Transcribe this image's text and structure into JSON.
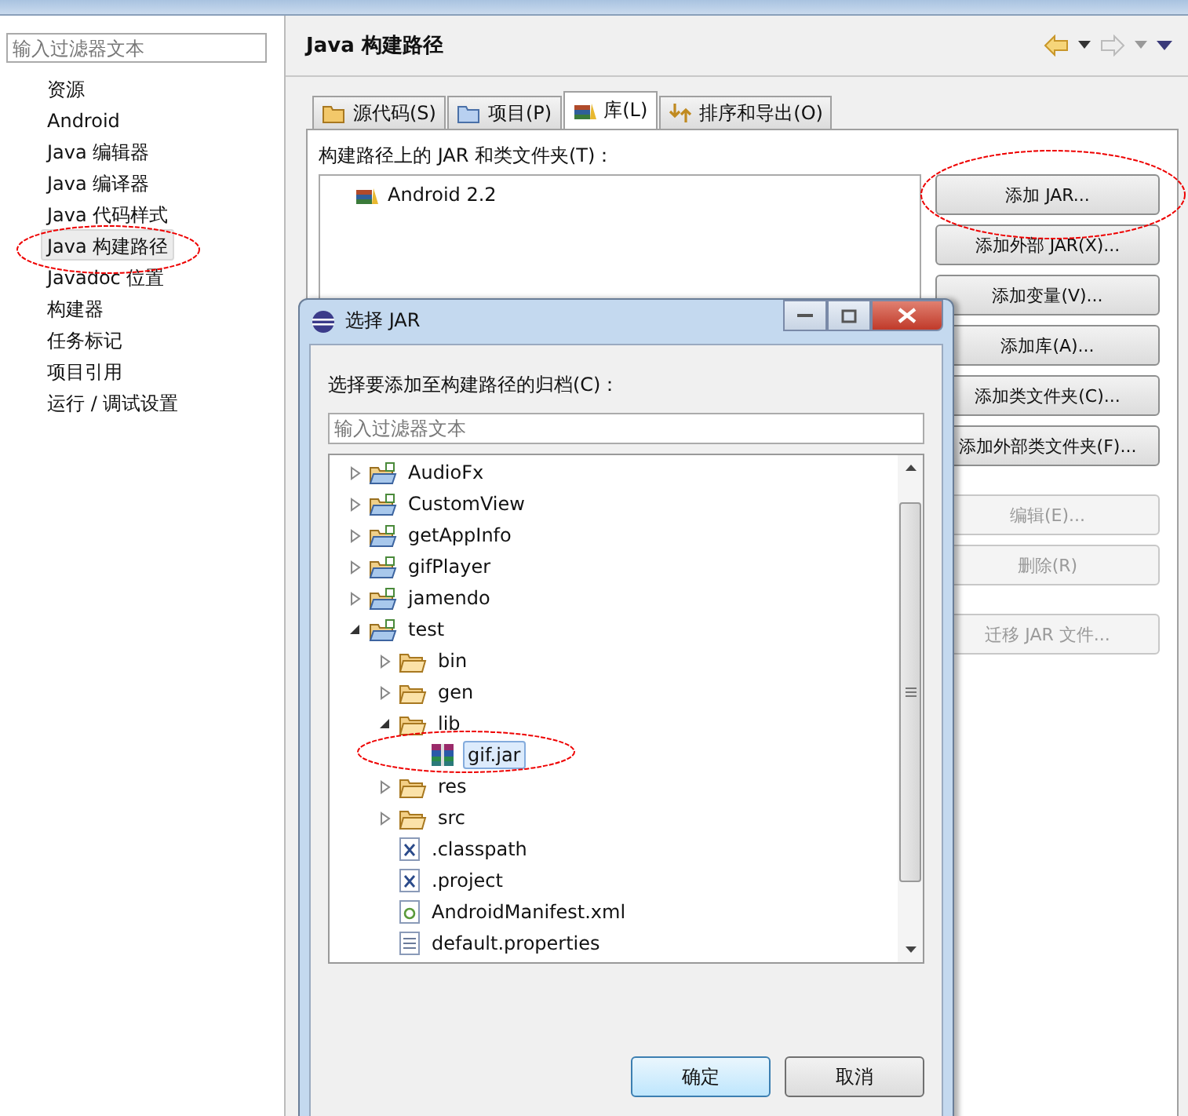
{
  "sidebar": {
    "filter": {
      "placeholder": "输入过滤器文本"
    },
    "items": [
      {
        "label": "资源",
        "selected": false
      },
      {
        "label": "Android",
        "selected": false
      },
      {
        "label": "Java 编辑器",
        "selected": false
      },
      {
        "label": "Java 编译器",
        "selected": false
      },
      {
        "label": "Java 代码样式",
        "selected": false
      },
      {
        "label": "Java 构建路径",
        "selected": true
      },
      {
        "label": "Javadoc 位置",
        "selected": false
      },
      {
        "label": "构建器",
        "selected": false
      },
      {
        "label": "任务标记",
        "selected": false
      },
      {
        "label": "项目引用",
        "selected": false
      },
      {
        "label": "运行 / 调试设置",
        "selected": false
      }
    ]
  },
  "page": {
    "title": "Java 构建路径",
    "tabs": [
      {
        "label": "源代码(S)",
        "kind": "source",
        "selected": false
      },
      {
        "label": "项目(P)",
        "kind": "project",
        "selected": false
      },
      {
        "label": "库(L)",
        "kind": "library",
        "selected": true
      },
      {
        "label": "排序和导出(O)",
        "kind": "order",
        "selected": false
      }
    ],
    "list_label": "构建路径上的 JAR 和类文件夹(T)：",
    "entries": [
      {
        "label": "Android 2.2"
      }
    ],
    "button_groups": [
      [
        {
          "label": "添加 JAR...",
          "disabled": false
        },
        {
          "label": "添加外部 JAR(X)...",
          "disabled": false
        },
        {
          "label": "添加变量(V)...",
          "disabled": false
        },
        {
          "label": "添加库(A)...",
          "disabled": false
        },
        {
          "label": "添加类文件夹(C)...",
          "disabled": false
        },
        {
          "label": "添加外部类文件夹(F)...",
          "disabled": false
        }
      ],
      [
        {
          "label": "编辑(E)...",
          "disabled": true
        },
        {
          "label": "删除(R)",
          "disabled": true
        }
      ],
      [
        {
          "label": "迁移 JAR 文件...",
          "disabled": true
        }
      ]
    ]
  },
  "dialog": {
    "title": "选择 JAR",
    "prompt": "选择要添加至构建路径的归档(C)：",
    "filter": {
      "placeholder": "输入过滤器文本"
    },
    "tree": [
      {
        "label": "AudioFx",
        "kind": "project",
        "expanded": false,
        "selected": false
      },
      {
        "label": "CustomView",
        "kind": "project",
        "expanded": false,
        "selected": false
      },
      {
        "label": "getAppInfo",
        "kind": "project",
        "expanded": false,
        "selected": false
      },
      {
        "label": "gifPlayer",
        "kind": "project",
        "expanded": false,
        "selected": false
      },
      {
        "label": "jamendo",
        "kind": "project",
        "expanded": false,
        "selected": false
      },
      {
        "label": "test",
        "kind": "project",
        "expanded": true,
        "selected": false,
        "children": [
          {
            "label": "bin",
            "kind": "folder",
            "expanded": false,
            "selected": false
          },
          {
            "label": "gen",
            "kind": "folder",
            "expanded": false,
            "selected": false
          },
          {
            "label": "lib",
            "kind": "folder",
            "expanded": true,
            "selected": false,
            "children": [
              {
                "label": "gif.jar",
                "kind": "jar",
                "selected": true
              }
            ]
          },
          {
            "label": "res",
            "kind": "folder",
            "expanded": false,
            "selected": false
          },
          {
            "label": "src",
            "kind": "folder",
            "expanded": false,
            "selected": false
          },
          {
            "label": ".classpath",
            "kind": "xml",
            "selected": false
          },
          {
            "label": ".project",
            "kind": "xml",
            "selected": false
          },
          {
            "label": "AndroidManifest.xml",
            "kind": "manifest",
            "selected": false
          },
          {
            "label": "default.properties",
            "kind": "text",
            "selected": false
          }
        ]
      }
    ],
    "buttons": [
      {
        "label": "确定",
        "kind": "default"
      },
      {
        "label": "取消",
        "kind": "normal"
      }
    ]
  }
}
